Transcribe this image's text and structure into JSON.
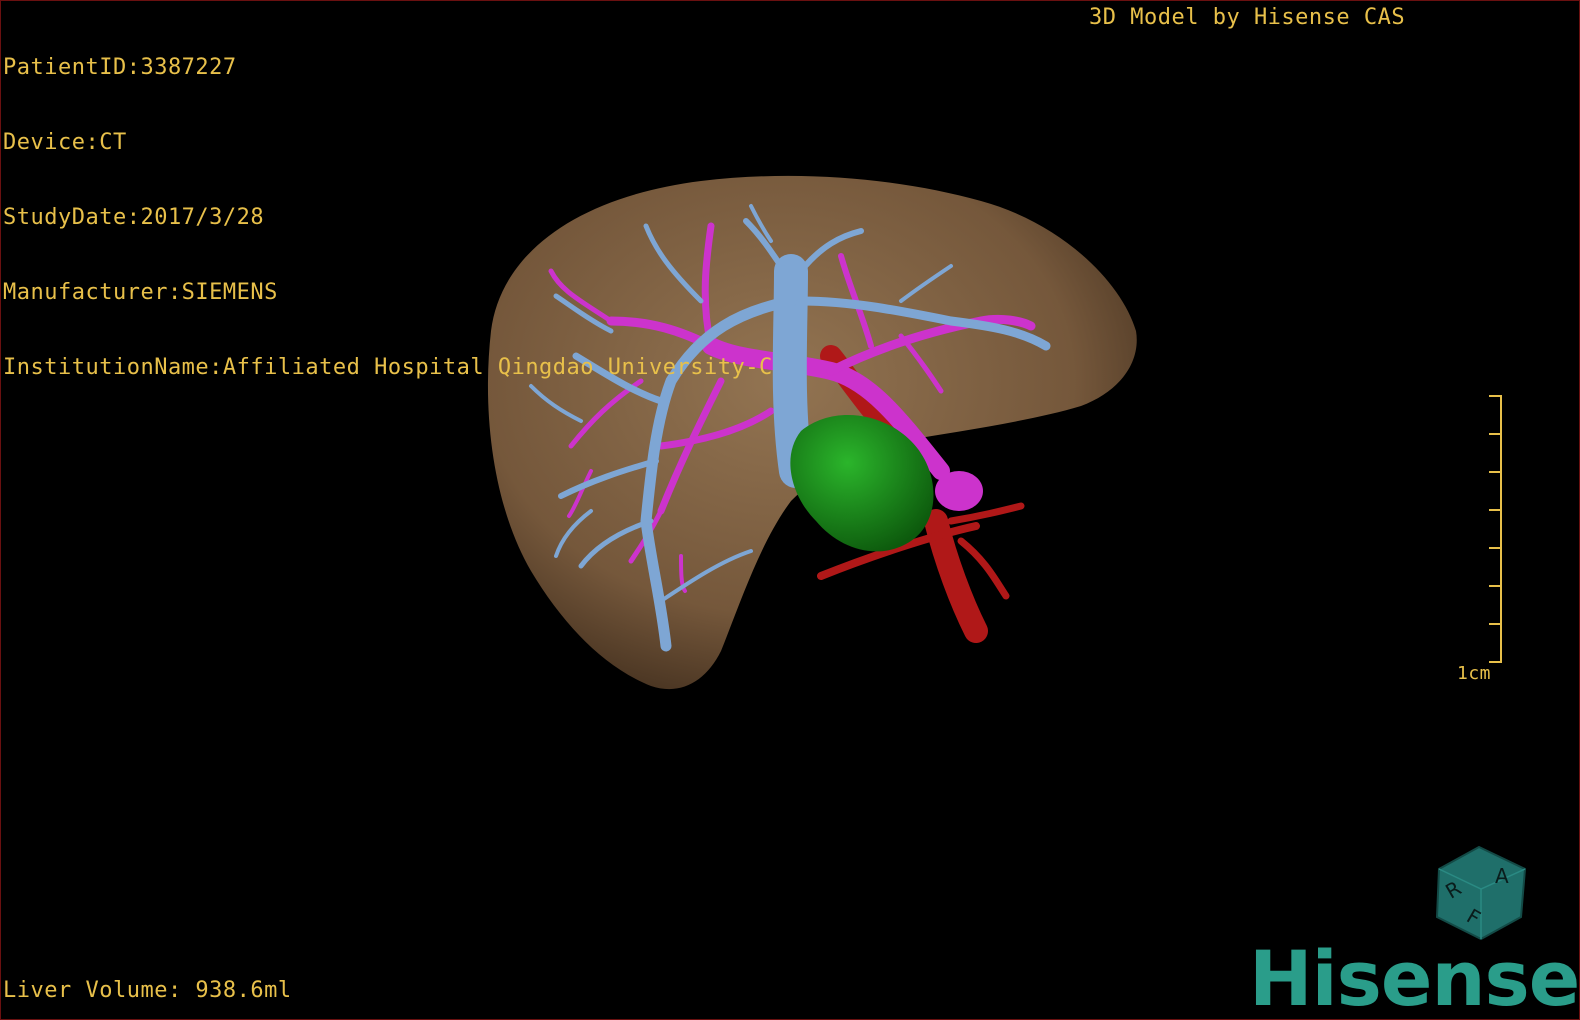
{
  "info": {
    "patient_id": "PatientID:3387227",
    "device": "Device:CT",
    "study_date": "StudyDate:2017/3/28",
    "manufacturer": "Manufacturer:SIEMENS",
    "institution": "InstitutionName:Affiliated Hospital Qingdao University-C"
  },
  "brand_title": "3D Model by Hisense CAS",
  "liver_volume": "Liver Volume: 938.6ml",
  "scale": {
    "label": "1cm"
  },
  "orientation_cube": {
    "letters": [
      "R",
      "A",
      "F"
    ]
  },
  "logo": "Hisense",
  "colors": {
    "overlay_text": "#e8c04a",
    "liver": "#8a6a48",
    "hepatic_vein": "#7ea6d4",
    "portal_vein": "#cc33cc",
    "artery": "#b01818",
    "lesion": "#1d8f1d",
    "cube": "#1f6f6a",
    "logo": "#2a9d8a"
  }
}
